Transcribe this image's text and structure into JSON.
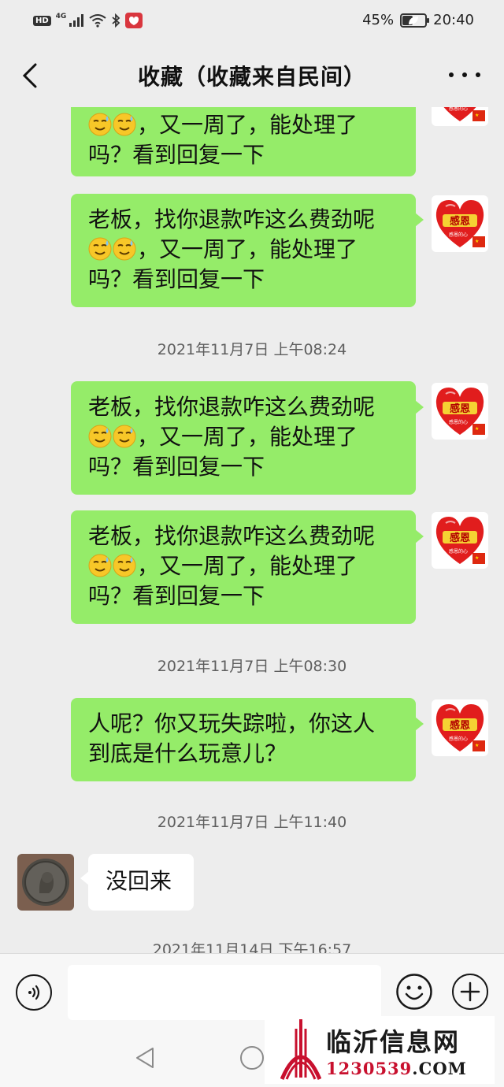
{
  "status_bar": {
    "hd_badge": "HD",
    "signal_label": "4G",
    "battery_text": "45%",
    "battery_level": 0.45,
    "time": "20:40"
  },
  "header": {
    "title": "收藏（收藏来自民间）",
    "back_icon": "chevron-left-icon",
    "more_icon": "ellipsis-icon"
  },
  "self_avatar": {
    "text_top": "感恩",
    "text_bottom": "感恩的心",
    "color": "#e11d1d"
  },
  "messages": [
    {
      "type": "self",
      "line2": "，又一周了，能处理了",
      "line3": "吗？看到回复一下"
    },
    {
      "type": "self",
      "line1": "老板，找你退款咋这么费劲呢",
      "line2": "，又一周了，能处理了",
      "line3": "吗？看到回复一下"
    },
    {
      "type": "time",
      "text": "2021年11月7日 上午08:24"
    },
    {
      "type": "self",
      "line1": "老板，找你退款咋这么费劲呢",
      "line2": "，又一周了，能处理了",
      "line3": "吗？看到回复一下"
    },
    {
      "type": "self",
      "line1": "老板，找你退款咋这么费劲呢",
      "line2": "，又一周了，能处理了",
      "line3": "吗？看到回复一下"
    },
    {
      "type": "time",
      "text": "2021年11月7日 上午08:30"
    },
    {
      "type": "self",
      "line1": "人呢？你又玩失踪啦，你这人",
      "line2": "到底是什么玩意儿？"
    },
    {
      "type": "time",
      "text": "2021年11月7日 上午11:40"
    },
    {
      "type": "other",
      "text": "没回来"
    },
    {
      "type": "time",
      "text": "2021年11月14日 下午16:57"
    }
  ],
  "input_bar": {
    "voice_icon": "voice-icon",
    "emoji_icon": "emoji-icon",
    "plus_icon": "plus-icon"
  },
  "watermark": {
    "title": "临沂信息网",
    "subtitle_a": "1230539",
    "subtitle_b": ".COM"
  }
}
